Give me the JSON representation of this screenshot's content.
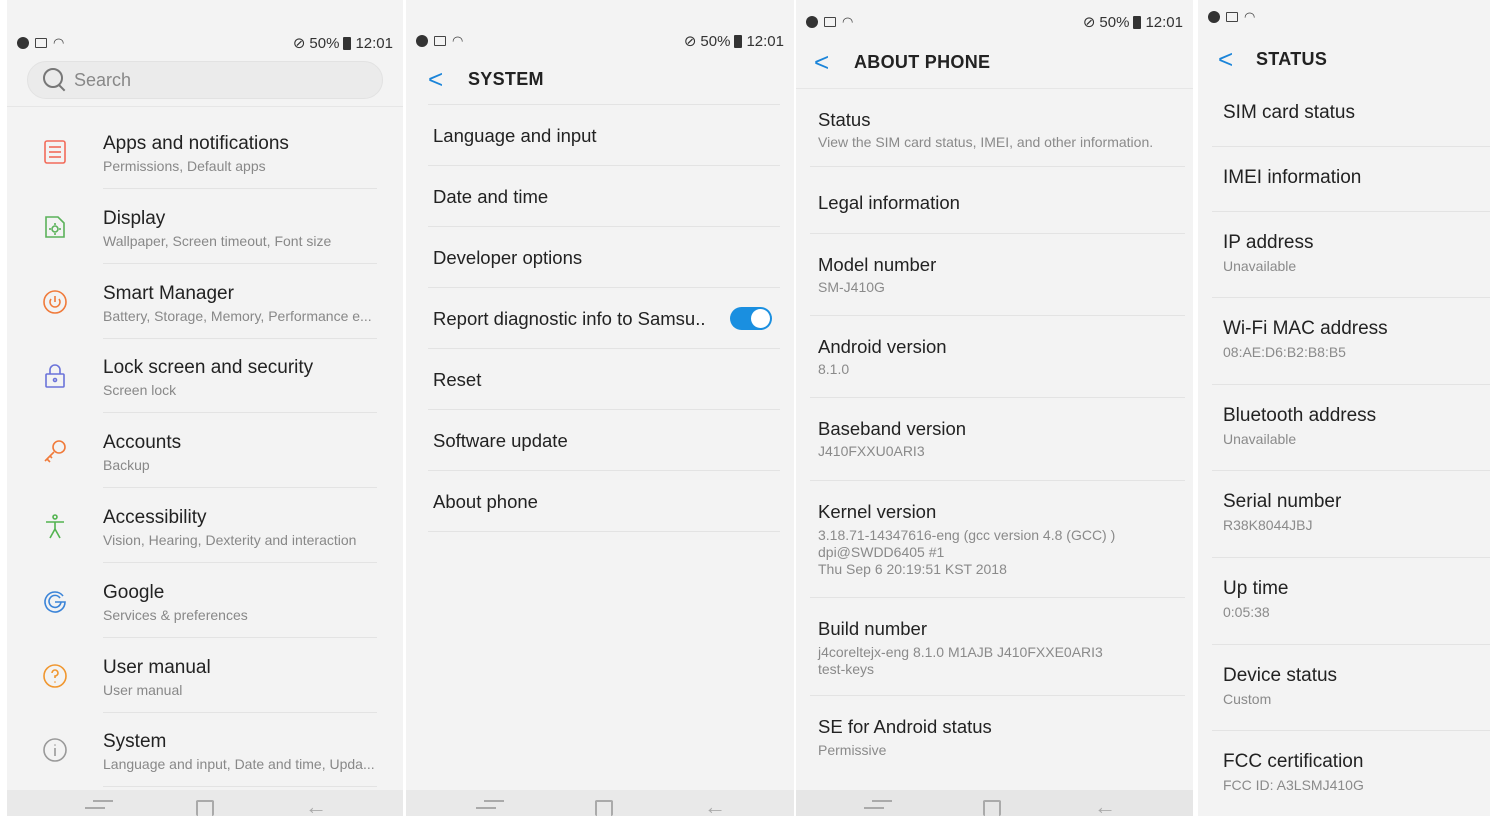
{
  "status_bar": {
    "battery": "50%",
    "time": "12:01"
  },
  "settings": {
    "search_placeholder": "Search",
    "items": [
      {
        "title": "Apps and notifications",
        "subtitle": "Permissions, Default apps",
        "icon": "apps-icon",
        "icon_color": "#f26b5a"
      },
      {
        "title": "Display",
        "subtitle": "Wallpaper, Screen timeout, Font size",
        "icon": "display-icon",
        "icon_color": "#5bb25a"
      },
      {
        "title": "Smart Manager",
        "subtitle": "Battery, Storage, Memory, Performance e...",
        "icon": "smart-manager-icon",
        "icon_color": "#f07a3a"
      },
      {
        "title": "Lock screen and security",
        "subtitle": "Screen lock",
        "icon": "lock-icon",
        "icon_color": "#6a72d9"
      },
      {
        "title": "Accounts",
        "subtitle": "Backup",
        "icon": "key-icon",
        "icon_color": "#f07a3a"
      },
      {
        "title": "Accessibility",
        "subtitle": "Vision, Hearing, Dexterity and interaction",
        "icon": "accessibility-icon",
        "icon_color": "#52b34f"
      },
      {
        "title": "Google",
        "subtitle": "Services & preferences",
        "icon": "google-icon",
        "icon_color": "#3b84d8"
      },
      {
        "title": "User manual",
        "subtitle": "User manual",
        "icon": "help-icon",
        "icon_color": "#f0962e"
      },
      {
        "title": "System",
        "subtitle": "Language and input, Date and time, Upda...",
        "icon": "info-icon",
        "icon_color": "#999999"
      }
    ]
  },
  "system": {
    "title": "SYSTEM",
    "items": [
      {
        "title": "Language and input"
      },
      {
        "title": "Date and time"
      },
      {
        "title": "Developer options"
      },
      {
        "title": "Report diagnostic info to Samsu..",
        "toggle": true
      },
      {
        "title": "Reset"
      },
      {
        "title": "Software update"
      },
      {
        "title": "About phone"
      }
    ]
  },
  "about": {
    "title": "ABOUT PHONE",
    "items": [
      {
        "title": "Status",
        "subtitle": "View the SIM card status, IMEI, and other information."
      },
      {
        "title": "Legal information",
        "subtitle": ""
      },
      {
        "title": "Model number",
        "subtitle": "SM-J410G"
      },
      {
        "title": "Android version",
        "subtitle": "8.1.0"
      },
      {
        "title": "Baseband version",
        "subtitle": "J410FXXU0ARI3"
      },
      {
        "title": "Kernel version",
        "subtitle": "3.18.71-14347616-eng (gcc version 4.8 (GCC) )\ndpi@SWDD6405 #1\nThu Sep 6 20:19:51 KST 2018"
      },
      {
        "title": "Build number",
        "subtitle": "j4coreltejx-eng 8.1.0 M1AJB J410FXXE0ARI3\ntest-keys"
      },
      {
        "title": "SE for Android status",
        "subtitle": "Permissive"
      }
    ]
  },
  "status_screen": {
    "title": "STATUS",
    "items": [
      {
        "title": "SIM card status",
        "subtitle": ""
      },
      {
        "title": "IMEI information",
        "subtitle": ""
      },
      {
        "title": "IP address",
        "subtitle": "Unavailable"
      },
      {
        "title": "Wi-Fi MAC address",
        "subtitle": "08:AE:D6:B2:B8:B5"
      },
      {
        "title": "Bluetooth address",
        "subtitle": "Unavailable"
      },
      {
        "title": "Serial number",
        "subtitle": "R38K8044JBJ"
      },
      {
        "title": "Up time",
        "subtitle": "0:05:38"
      },
      {
        "title": "Device status",
        "subtitle": "Custom"
      },
      {
        "title": "FCC certification",
        "subtitle": "FCC ID: A3LSMJ410G"
      }
    ]
  }
}
